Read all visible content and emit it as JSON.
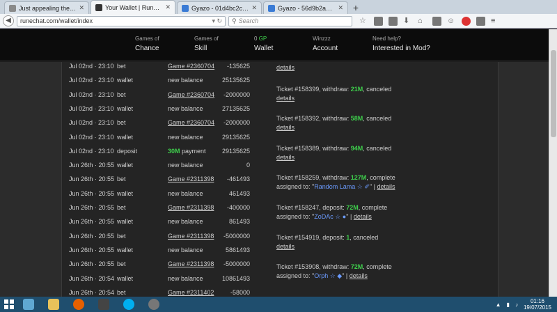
{
  "browser": {
    "tabs": [
      {
        "title": "Just appealing the latest bu...",
        "active": false
      },
      {
        "title": "Your Wallet | RuneChat",
        "active": true
      },
      {
        "title": "Gyazo - 01d4bc2ccb65d521...",
        "active": false
      },
      {
        "title": "Gyazo - 56d9b2a75017afe4...",
        "active": false
      }
    ],
    "url": "runechat.com/wallet/index",
    "search_placeholder": "Search",
    "new_tab_label": "+"
  },
  "site_menu": [
    {
      "small": "Games of",
      "big": "Chance"
    },
    {
      "small": "Games of",
      "big": "Skill"
    },
    {
      "small": "0",
      "small_suffix": "GP",
      "big": "Wallet"
    },
    {
      "small": "Winzzz",
      "big": "Account"
    },
    {
      "small": "Need help?",
      "big": "Interested in Mod?"
    }
  ],
  "transactions": [
    {
      "date": "Jul 02nd · 23:10",
      "type": "bet",
      "desc": "Game #2360704",
      "amount": "-135625",
      "link": true
    },
    {
      "date": "Jul 02nd · 23:10",
      "type": "wallet",
      "desc": "new balance",
      "amount": "25135625",
      "link": false
    },
    {
      "date": "Jul 02nd · 23:10",
      "type": "bet",
      "desc": "Game #2360704",
      "amount": "-2000000",
      "link": true
    },
    {
      "date": "Jul 02nd · 23:10",
      "type": "wallet",
      "desc": "new balance",
      "amount": "27135625",
      "link": false
    },
    {
      "date": "Jul 02nd · 23:10",
      "type": "bet",
      "desc": "Game #2360704",
      "amount": "-2000000",
      "link": true
    },
    {
      "date": "Jul 02nd · 23:10",
      "type": "wallet",
      "desc": "new balance",
      "amount": "29135625",
      "link": false
    },
    {
      "date": "Jul 02nd · 23:10",
      "type": "deposit",
      "desc_highlight": "30M",
      "desc": "payment",
      "amount": "29135625",
      "link": false
    },
    {
      "date": "Jun 26th · 20:55",
      "type": "wallet",
      "desc": "new balance",
      "amount": "0",
      "link": false
    },
    {
      "date": "Jun 26th · 20:55",
      "type": "bet",
      "desc": "Game #2311398",
      "amount": "-461493",
      "link": true
    },
    {
      "date": "Jun 26th · 20:55",
      "type": "wallet",
      "desc": "new balance",
      "amount": "461493",
      "link": false
    },
    {
      "date": "Jun 26th · 20:55",
      "type": "bet",
      "desc": "Game #2311398",
      "amount": "-400000",
      "link": true
    },
    {
      "date": "Jun 26th · 20:55",
      "type": "wallet",
      "desc": "new balance",
      "amount": "861493",
      "link": false
    },
    {
      "date": "Jun 26th · 20:55",
      "type": "bet",
      "desc": "Game #2311398",
      "amount": "-5000000",
      "link": true
    },
    {
      "date": "Jun 26th · 20:55",
      "type": "wallet",
      "desc": "new balance",
      "amount": "5861493",
      "link": false
    },
    {
      "date": "Jun 26th · 20:55",
      "type": "bet",
      "desc": "Game #2311398",
      "amount": "-5000000",
      "link": true
    },
    {
      "date": "Jun 26th · 20:54",
      "type": "wallet",
      "desc": "new balance",
      "amount": "10861493",
      "link": false
    },
    {
      "date": "Jun 26th · 20:54",
      "type": "bet",
      "desc": "Game #2311402",
      "amount": "-58000",
      "link": true
    }
  ],
  "tickets": [
    {
      "text": "",
      "details": "details"
    },
    {
      "prefix": "Ticket #158399, withdraw: ",
      "value": "21M",
      "suffix": ", canceled",
      "details": "details"
    },
    {
      "prefix": "Ticket #158392, withdraw: ",
      "value": "58M",
      "suffix": ", canceled",
      "details": "details"
    },
    {
      "prefix": "Ticket #158389, withdraw: ",
      "value": "94M",
      "suffix": ", canceled",
      "details": "details"
    },
    {
      "prefix": "Ticket #158259, withdraw: ",
      "value": "127M",
      "suffix": ", complete",
      "assigned_prefix": "assigned to: \"",
      "user": "Random Lama ☆ ✐",
      "assigned_suffix": "\" |",
      "details": "details"
    },
    {
      "prefix": "Ticket #158247, deposit: ",
      "value": "72M",
      "suffix": ", complete",
      "assigned_prefix": "assigned to: \"",
      "user": "ZoDAc ☆ ●",
      "assigned_suffix": "\" |",
      "details": "details"
    },
    {
      "prefix": "Ticket #154919, deposit: ",
      "value": "1",
      "suffix": ", canceled",
      "details": "details"
    },
    {
      "prefix": "Ticket #153908, withdraw: ",
      "value": "72M",
      "suffix": ", complete",
      "assigned_prefix": "assigned to: \"",
      "user": "Orph ☆ ◆",
      "assigned_suffix": "\" |",
      "details": "details"
    }
  ],
  "taskbar": {
    "time": "01:16",
    "date": "19/07/2015"
  },
  "colors": {
    "gp_green": "#3ecf4c",
    "user_blue": "#6b9bff",
    "taskbar": "#1f4e6e"
  }
}
